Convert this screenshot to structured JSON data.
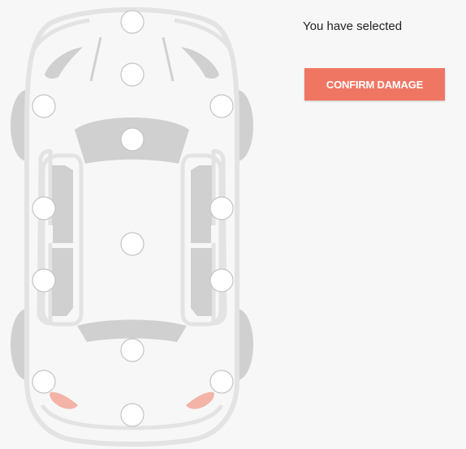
{
  "panel": {
    "selected_label": "You have selected",
    "confirm_button_label": "CONFIRM DAMAGE"
  },
  "colors": {
    "button_bg": "#f07664",
    "car_outline": "#e3e3e3",
    "car_fill": "#d0d0d0",
    "damage_highlight": "#f4b3a7"
  },
  "hotspots": [
    {
      "name": "hotspot-front-bumper"
    },
    {
      "name": "hotspot-hood"
    },
    {
      "name": "hotspot-front-left-fender"
    },
    {
      "name": "hotspot-front-right-fender"
    },
    {
      "name": "hotspot-windshield"
    },
    {
      "name": "hotspot-front-left-door"
    },
    {
      "name": "hotspot-front-right-door"
    },
    {
      "name": "hotspot-roof"
    },
    {
      "name": "hotspot-rear-left-door"
    },
    {
      "name": "hotspot-rear-right-door"
    },
    {
      "name": "hotspot-rear-window"
    },
    {
      "name": "hotspot-rear-left-quarter"
    },
    {
      "name": "hotspot-rear-right-quarter"
    },
    {
      "name": "hotspot-rear-bumper"
    }
  ],
  "damaged_parts": [
    "rear-left-light",
    "rear-right-light"
  ]
}
